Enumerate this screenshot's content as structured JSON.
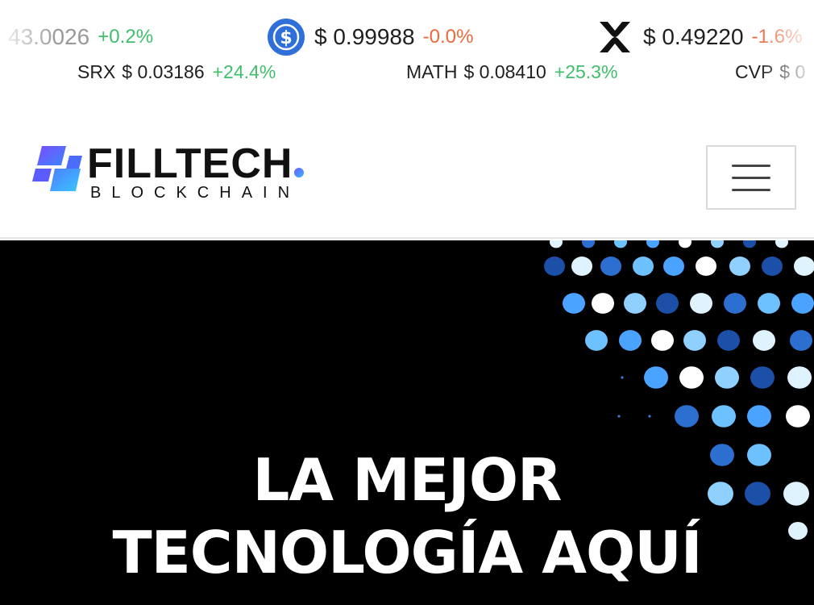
{
  "ticker": {
    "row1": [
      {
        "price": "43.0026",
        "change": "+0.2%",
        "direction": "up"
      },
      {
        "icon": "usdc-icon",
        "price": "$ 0.99988",
        "change": "-0.0%",
        "direction": "down"
      },
      {
        "icon": "xrp-icon",
        "price": "$ 0.49220",
        "change": "-1.6%",
        "direction": "down"
      }
    ],
    "row2": [
      {
        "symbol": "SRX",
        "price": "$ 0.03186",
        "change": "+24.4%",
        "direction": "up"
      },
      {
        "symbol": "MATH",
        "price": "$ 0.08410",
        "change": "+25.3%",
        "direction": "up"
      },
      {
        "symbol": "CVP",
        "price": "$ 0",
        "change": "",
        "direction": "up"
      }
    ]
  },
  "header": {
    "logo_main": "FILLTECH",
    "logo_sub": "BLOCKCHAIN",
    "menu_icon": "hamburger-icon"
  },
  "hero": {
    "title_line1": "LA MEJOR",
    "title_line2": "TECNOLOGÍA AQUÍ"
  },
  "colors": {
    "positive": "#3fbf6b",
    "negative": "#ea6a3c",
    "hero_bg": "#000000",
    "accent_blue": "#2f6df6",
    "accent_purple": "#6a5cff"
  }
}
